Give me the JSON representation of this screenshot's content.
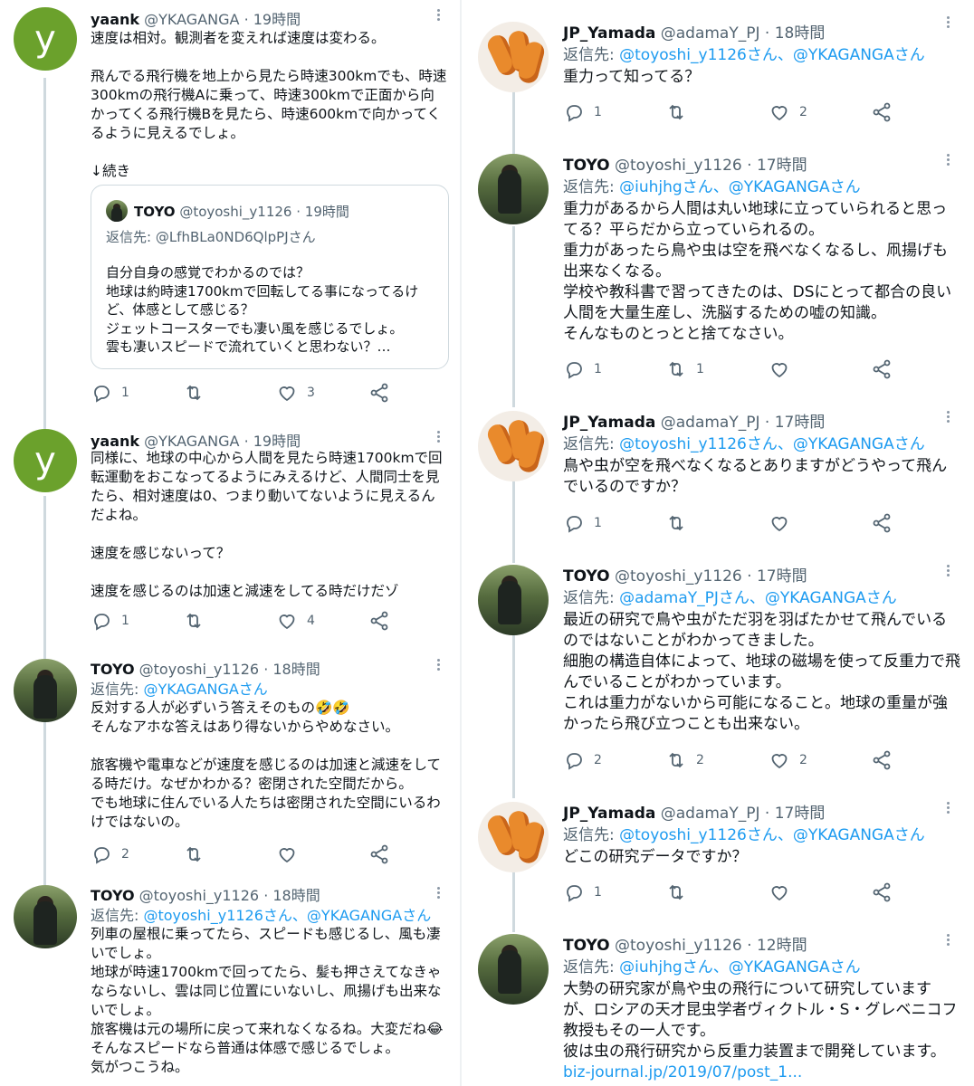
{
  "left_column": {
    "tweet1": {
      "name": "yaank",
      "handle": "@YKAGANGA",
      "time": "· 19時間",
      "avatar_letter": "y",
      "body": "速度は相対。観測者を変えれば速度は変わる。\n\n飛んでる飛行機を地上から見たら時速300kmでも、時速300kmの飛行機Aに乗って、時速300kmで正面から向かってくる飛行機Bを見たら、時速600kmで向かってくるように見えるでしょ。\n\n↓続き",
      "quote": {
        "name": "TOYO",
        "handle": "@toyoshi_y1126",
        "time": "· 19時間",
        "reply_prefix": "返信先: ",
        "reply_to": "@LfhBLa0ND6QlpPJさん",
        "body": "自分自身の感覚でわかるのでは？\n地球は約時速1700kmで回転してる事になってるけど、体感として感じる？\nジェットコースターでも凄い風を感じるでしょ。\n雲も凄いスピードで流れていくと思わない？…"
      },
      "replies": "1",
      "retweets": "",
      "likes": "3"
    },
    "tweet2": {
      "name": "yaank",
      "handle": "@YKAGANGA",
      "time": "· 19時間",
      "avatar_letter": "y",
      "body": "同様に、地球の中心から人間を見たら時速1700kmで回転運動をおこなってるようにみえるけど、人間同士を見たら、相対速度は0、つまり動いてないように見えるんだよね。\n\n速度を感じないって？\n\n速度を感じるのは加速と減速をしてる時だけだゾ",
      "replies": "1",
      "retweets": "",
      "likes": "4"
    },
    "tweet3": {
      "name": "TOYO",
      "handle": "@toyoshi_y1126",
      "time": "· 18時間",
      "reply_prefix": "返信先: ",
      "reply_to": "@YKAGANGAさん",
      "body": "反対する人が必ずいう答えそのもの🤣🤣\nそんなアホな答えはあり得ないからやめなさい。\n\n旅客機や電車などが速度を感じるのは加速と減速をしてる時だけ。なぜかわかる？密閉された空間だから。\nでも地球に住んでいる人たちは密閉された空間にいるわけではないの。",
      "replies": "2",
      "retweets": "",
      "likes": ""
    },
    "tweet4": {
      "name": "TOYO",
      "handle": "@toyoshi_y1126",
      "time": "· 18時間",
      "reply_prefix": "返信先: ",
      "reply_to": "@toyoshi_y1126さん、@YKAGANGAさん",
      "body": "列車の屋根に乗ってたら、スピードも感じるし、風も凄いでしょ。\n地球が時速1700kmで回ってたら、髪も押さえてなきゃならないし、雲は同じ位置にいないし、凧揚げも出来ないでしょ。\n旅客機は元の場所に戻って来れなくなるね。大変だね😂\nそんなスピードなら普通は体感で感じるでしょ。\n気がつこうね。"
    }
  },
  "right_column": {
    "tweet1": {
      "name": "JP_Yamada",
      "handle": "@adamaY_PJ",
      "time": "· 18時間",
      "reply_prefix": "返信先: ",
      "reply_to": "@toyoshi_y1126さん、@YKAGANGAさん",
      "body": "重力って知ってる？",
      "replies": "1",
      "retweets": "",
      "likes": "2"
    },
    "tweet2": {
      "name": "TOYO",
      "handle": "@toyoshi_y1126",
      "time": "· 17時間",
      "reply_prefix": "返信先: ",
      "reply_to": "@iuhjhgさん、@YKAGANGAさん",
      "body": "重力があるから人間は丸い地球に立っていられると思ってる？平らだから立っていられるの。\n重力があったら鳥や虫は空を飛べなくなるし、凧揚げも出来なくなる。\n学校や教科書で習ってきたのは、DSにとって都合の良い人間を大量生産し、洗脳するための嘘の知識。\nそんなものとっとと捨てなさい。",
      "replies": "1",
      "retweets": "1",
      "likes": ""
    },
    "tweet3": {
      "name": "JP_Yamada",
      "handle": "@adamaY_PJ",
      "time": "· 17時間",
      "reply_prefix": "返信先: ",
      "reply_to": "@toyoshi_y1126さん、@YKAGANGAさん",
      "body": "鳥や虫が空を飛べなくなるとありますがどうやって飛んでいるのですか？",
      "replies": "1",
      "retweets": "",
      "likes": ""
    },
    "tweet4": {
      "name": "TOYO",
      "handle": "@toyoshi_y1126",
      "time": "· 17時間",
      "reply_prefix": "返信先: ",
      "reply_to": "@adamaY_PJさん、@YKAGANGAさん",
      "body": "最近の研究で鳥や虫がただ羽を羽ばたかせて飛んでいるのではないことがわかってきました。\n細胞の構造自体によって、地球の磁場を使って反重力で飛んでいることがわかっています。\nこれは重力がないから可能になること。地球の重量が強かったら飛び立つことも出来ない。",
      "replies": "2",
      "retweets": "2",
      "likes": "2"
    },
    "tweet5": {
      "name": "JP_Yamada",
      "handle": "@adamaY_PJ",
      "time": "· 17時間",
      "reply_prefix": "返信先: ",
      "reply_to": "@toyoshi_y1126さん、@YKAGANGAさん",
      "body": "どこの研究データですか？",
      "replies": "1",
      "retweets": "",
      "likes": ""
    },
    "tweet6": {
      "name": "TOYO",
      "handle": "@toyoshi_y1126",
      "time": "· 12時間",
      "reply_prefix": "返信先: ",
      "reply_to": "@iuhjhgさん、@YKAGANGAさん",
      "body": "大勢の研究家が鳥や虫の飛行について研究していますが、ロシアの天才昆虫学者ヴィクトル・S・グレベニコフ教授もその一人です。\n彼は虫の飛行研究から反重力装置まで開発しています。",
      "url": "biz-journal.jp/2019/07/post_1..."
    }
  },
  "colors": {
    "accent": "#1d9bf0",
    "muted": "#536471",
    "text": "#0f1419",
    "avatar_y": "#6ba12c"
  },
  "icons": [
    "reply-icon",
    "retweet-icon",
    "like-icon",
    "share-icon",
    "more-icon"
  ]
}
